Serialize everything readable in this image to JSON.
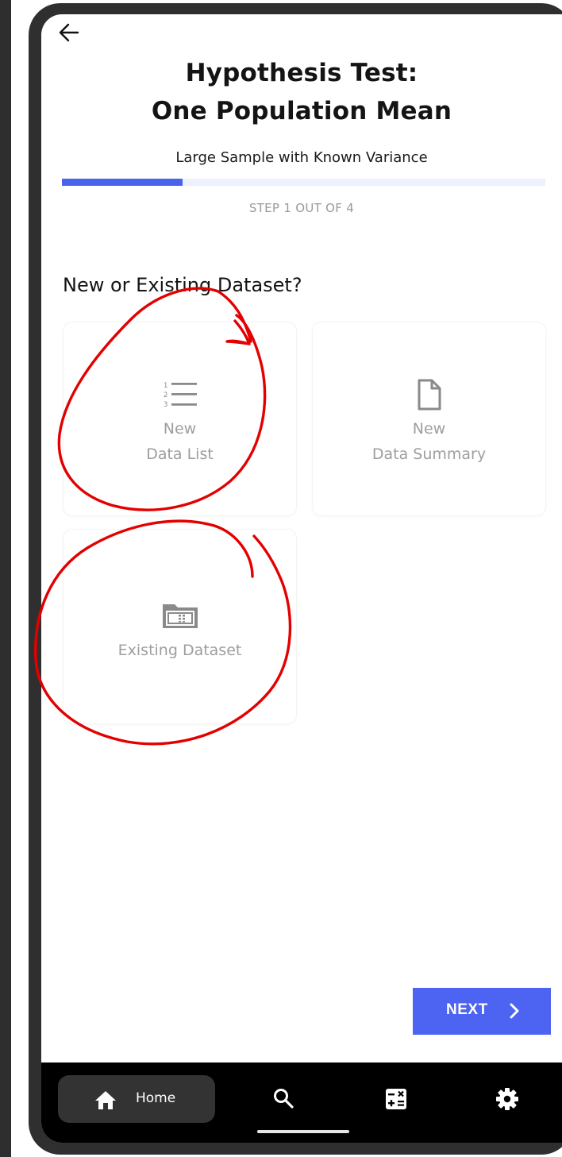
{
  "screen": {
    "title_line1": "Hypothesis Test:",
    "title_line2": "One Population Mean",
    "subtitle": "Large Sample with Known Variance",
    "progress": {
      "step_label": "STEP 1 OUT OF 4",
      "current_step": 1,
      "total_steps": 4,
      "fraction": 0.25,
      "color": "#4a63ee"
    },
    "section_title": "New or Existing Dataset?",
    "options": [
      {
        "line1": "New",
        "line2": "Data List",
        "icon": "numbered-list-icon"
      },
      {
        "line1": "New",
        "line2": "Data Summary",
        "icon": "document-icon"
      },
      {
        "line1": "Existing Dataset",
        "icon": "folder-table-icon"
      }
    ],
    "next_button": {
      "label": "NEXT",
      "icon": "chevron-right-icon",
      "color": "#4d63f2"
    }
  },
  "bottom_nav": {
    "items": [
      {
        "label": "Home",
        "icon": "home-icon",
        "active": true
      },
      {
        "icon": "search-icon"
      },
      {
        "icon": "calculator-icon"
      },
      {
        "icon": "gear-icon"
      }
    ]
  },
  "annotations": {
    "color": "#e30000",
    "marks": [
      "circle around New Data List",
      "circle around Existing Dataset"
    ]
  }
}
